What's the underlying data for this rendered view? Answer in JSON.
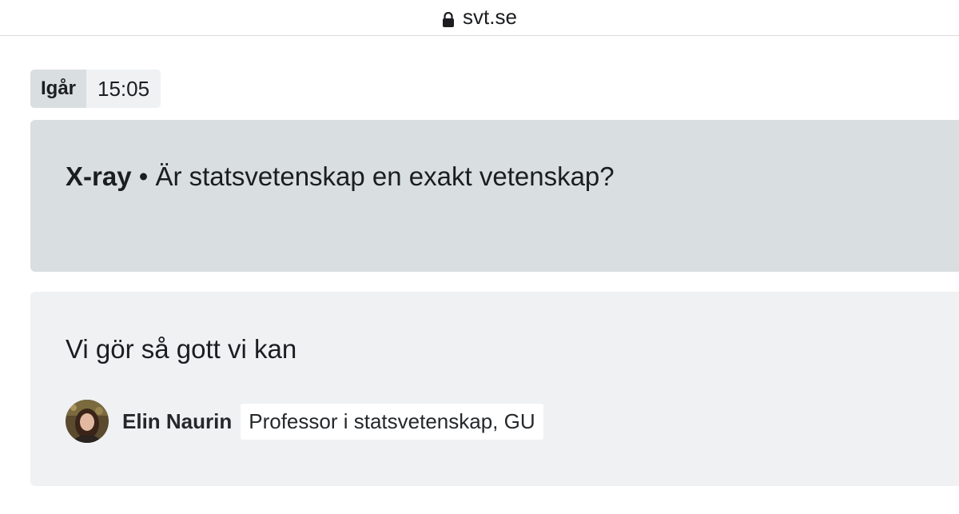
{
  "browser": {
    "url": "svt.se",
    "lock_icon": "lock-icon"
  },
  "post": {
    "day": "Igår",
    "time": "15:05"
  },
  "question": {
    "program": "X-ray",
    "separator": "•",
    "text": "Är statsvetenskap en exakt vetenskap?"
  },
  "answer": {
    "text": "Vi gör så gott vi kan",
    "author_name": "Elin Naurin",
    "author_title": "Professor i statsvetenskap, GU",
    "avatar_icon": "avatar-photo"
  },
  "colors": {
    "question_bg": "#d9dfe0",
    "answer_bg": "#eff1f3",
    "day_bg": "#d9dee0",
    "time_bg": "#eff1f3"
  }
}
